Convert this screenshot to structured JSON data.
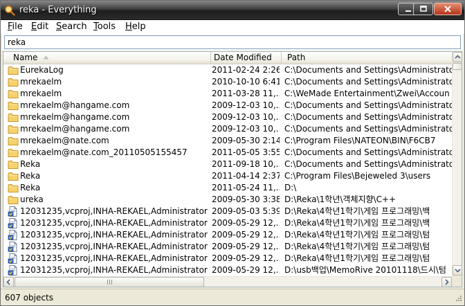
{
  "window": {
    "title": "reka - Everything"
  },
  "menu": [
    {
      "u": "F",
      "rest": "ile"
    },
    {
      "u": "E",
      "rest": "dit"
    },
    {
      "u": "S",
      "rest": "earch"
    },
    {
      "u": "T",
      "rest": "ools"
    },
    {
      "u": "H",
      "rest": "elp"
    }
  ],
  "search": {
    "value": "reka"
  },
  "columns": {
    "name": "Name",
    "date": "Date Modified",
    "path": "Path"
  },
  "rows": [
    {
      "type": "folder",
      "name": "EurekaLog",
      "date": "2011-02-24  2:26",
      "path": "C:\\Documents and Settings\\Administrato"
    },
    {
      "type": "folder",
      "name": "mrekaelm",
      "date": "2010-10-10  6:41",
      "path": "C:\\Documents and Settings\\Administrato"
    },
    {
      "type": "folder",
      "name": "mrekaelm",
      "date": "2011-03-28  11,..",
      "path": "C:\\WeMade Entertainment\\Zwei\\Accoun"
    },
    {
      "type": "folder",
      "name": "mrekaelm@hangame.com",
      "date": "2009-12-03  10,..",
      "path": "C:\\Documents and Settings\\Administrato"
    },
    {
      "type": "folder",
      "name": "mrekaelm@hangame.com",
      "date": "2009-12-03  10,..",
      "path": "C:\\Documents and Settings\\Administrato"
    },
    {
      "type": "folder",
      "name": "mrekaelm@hangame.com",
      "date": "2009-12-03  10,..",
      "path": "C:\\Documents and Settings\\Administrato"
    },
    {
      "type": "folder",
      "name": "mrekaelm@nate.com",
      "date": "2009-05-30  2:14",
      "path": "C:\\Program Files\\NATEON\\BIN\\F6CB7"
    },
    {
      "type": "folder",
      "name": "mrekaelm@nate.com_20110505155457",
      "date": "2011-05-05  3:55",
      "path": "C:\\Documents and Settings\\Administrato"
    },
    {
      "type": "folder",
      "name": "Reka",
      "date": "2011-09-18  10,..",
      "path": "C:\\Documents and Settings\\Administrato"
    },
    {
      "type": "folder",
      "name": "Reka",
      "date": "2011-04-14  2:37",
      "path": "C:\\Program Files\\Bejeweled 3\\users"
    },
    {
      "type": "folder",
      "name": "Reka",
      "date": "2011-05-24  11,..",
      "path": "D:\\"
    },
    {
      "type": "folder",
      "name": "ureka",
      "date": "2009-05-30  3:38",
      "path": "D:\\Reka\\1학년\\객체지향\\C++"
    },
    {
      "type": "file",
      "name": "12031235,vcproj,INHA-REKAEL,Administrator,...",
      "date": "2009-05-03  5:39",
      "path": "D:\\Reka\\4학년1학기\\게임 프로그래밍\\백"
    },
    {
      "type": "file",
      "name": "12031235,vcproj,INHA-REKAEL,Administrator,...",
      "date": "2009-05-29  12,..",
      "path": "D:\\Reka\\4학년1학기\\게임 프로그래밍\\백"
    },
    {
      "type": "file",
      "name": "12031235,vcproj,INHA-REKAEL,Administrator,...",
      "date": "2009-05-29  12,..",
      "path": "D:\\Reka\\4학년1학기\\게임 프로그래밍\\텀"
    },
    {
      "type": "file",
      "name": "12031235,vcproj,INHA-REKAEL,Administrator,...",
      "date": "2009-05-29  12,..",
      "path": "D:\\Reka\\4학년1학기\\게임 프로그래밍\\텀"
    },
    {
      "type": "file",
      "name": "12031235,vcproj,INHA-REKAEL,Administrator,...",
      "date": "2009-05-29  12,..",
      "path": "D:\\Reka\\4학년1학기\\게임 프로그래밍\\텀"
    },
    {
      "type": "file",
      "name": "12031235,vcproj,INHA-REKAEL,Administrator,...",
      "date": "2009-05-29  12,..",
      "path": "D:\\usb백업\\MemoRive 20101118\\드시\\텀"
    }
  ],
  "status": {
    "text": "607 objects"
  },
  "colors": {
    "folder": "#f2c54a",
    "selection_border": "#7f9db9"
  },
  "icons": {
    "app": "everything-app-icon",
    "folder": "folder-icon",
    "file": "project-file-icon"
  }
}
